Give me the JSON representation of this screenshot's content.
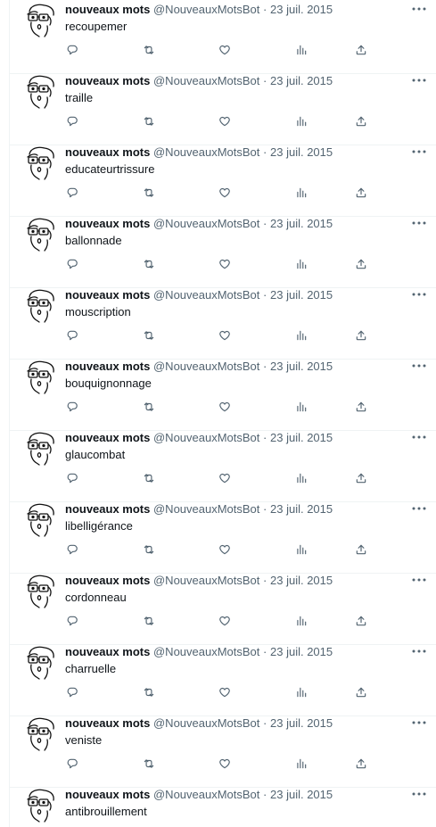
{
  "account": {
    "display_name": "nouveaux mots",
    "handle": "@NouveauxMotsBot",
    "separator": "·",
    "date": "23 juil. 2015"
  },
  "tweets": [
    {
      "text": "recoupemer"
    },
    {
      "text": "traille"
    },
    {
      "text": "educateurtrissure"
    },
    {
      "text": "ballonnade"
    },
    {
      "text": "mouscription"
    },
    {
      "text": "bouquignonnage"
    },
    {
      "text": "glaucombat"
    },
    {
      "text": "libelligérance"
    },
    {
      "text": "cordonneau"
    },
    {
      "text": "charruelle"
    },
    {
      "text": "veniste"
    },
    {
      "text": "antibrouillement"
    }
  ],
  "icons": [
    "avatar",
    "more-icon",
    "reply-icon",
    "retweet-icon",
    "like-icon",
    "views-icon",
    "share-icon"
  ],
  "colors": {
    "muted": "#536471",
    "text": "#0f1419",
    "divider": "#eff3f4"
  }
}
